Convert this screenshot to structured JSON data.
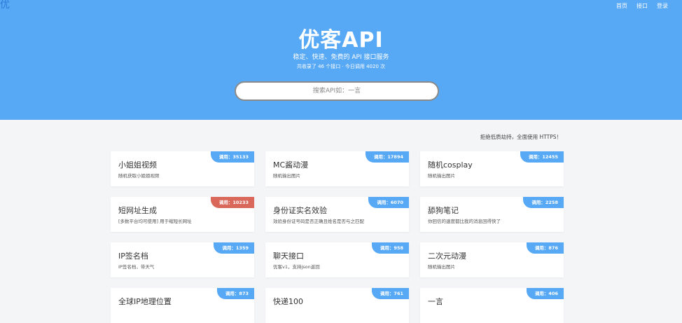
{
  "logo": "优",
  "nav": [
    "首页",
    "接口",
    "登录"
  ],
  "hero": {
    "title": "优客API",
    "subtitle": "稳定、快速、免费的 API 接口服务",
    "stats": "共收录了 46 个接口 · 今日调用 4020 次"
  },
  "search": {
    "placeholder": "搜索API如：一言"
  },
  "notice": "拒绝低质劫持，全面使用 HTTPS！",
  "cards": [
    {
      "name": "小姐姐视频",
      "desc": "随机获取小姐姐视频",
      "calls": "调用：35133",
      "badge_color": "#58a9f5"
    },
    {
      "name": "MC酱动漫",
      "desc": "随机输出图片",
      "calls": "调用：17894",
      "badge_color": "#58a9f5"
    },
    {
      "name": "随机cosplay",
      "desc": "随机输出图片",
      "calls": "调用：12455",
      "badge_color": "#58a9f5"
    },
    {
      "name": "短网址生成",
      "desc": "[多数平台均可使用] 用于缩短长网址",
      "calls": "调用：10233",
      "badge_color": "#d9685a"
    },
    {
      "name": "身份证实名效验",
      "desc": "效验身份证号码是否正确且姓名是否与之匹配",
      "calls": "调用：6070",
      "badge_color": "#58a9f5"
    },
    {
      "name": "舔狗笔记",
      "desc": "你回信的速度都比我的消息回得快了",
      "calls": "调用：2258",
      "badge_color": "#58a9f5"
    },
    {
      "name": "IP签名档",
      "desc": "IP签名档，带天气",
      "calls": "调用：1359",
      "badge_color": "#58a9f5"
    },
    {
      "name": "聊天接口",
      "desc": "优客v1，支持json返回",
      "calls": "调用：958",
      "badge_color": "#58a9f5"
    },
    {
      "name": "二次元动漫",
      "desc": "随机输出图片",
      "calls": "调用：876",
      "badge_color": "#58a9f5"
    },
    {
      "name": "全球IP地理位置",
      "desc": "",
      "calls": "调用：873",
      "badge_color": "#58a9f5"
    },
    {
      "name": "快递100",
      "desc": "",
      "calls": "调用：761",
      "badge_color": "#58a9f5"
    },
    {
      "name": "一言",
      "desc": "",
      "calls": "调用：406",
      "badge_color": "#58a9f5"
    }
  ]
}
